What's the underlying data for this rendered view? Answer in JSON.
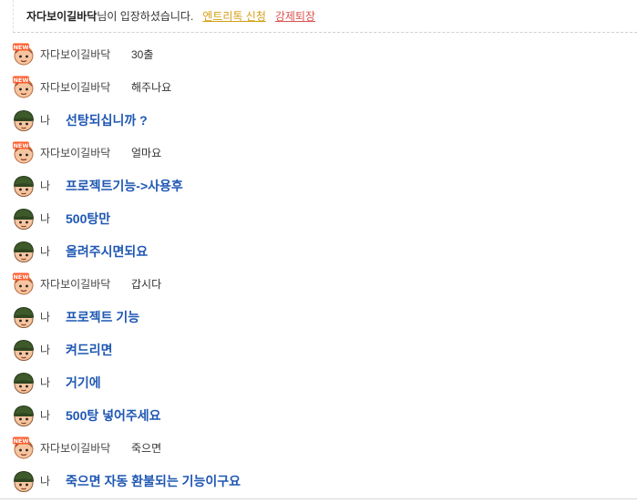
{
  "notice": {
    "nickname": "자다보이길바닥",
    "message": "님이 입장하셨습니다.",
    "entry_label": "엔트리톡 신청",
    "kick_label": "강제퇴장"
  },
  "messages": [
    {
      "type": "other",
      "name": "자다보이길바닥",
      "text": "30출"
    },
    {
      "type": "other",
      "name": "자다보이길바닥",
      "text": "해주나요"
    },
    {
      "type": "me",
      "name": "나",
      "text": "선탕되십니까 ?"
    },
    {
      "type": "other",
      "name": "자다보이길바닥",
      "text": "얼마요"
    },
    {
      "type": "me",
      "name": "나",
      "text": "프로젝트기능->사용후"
    },
    {
      "type": "me",
      "name": "나",
      "text": "500탕만"
    },
    {
      "type": "me",
      "name": "나",
      "text": "올려주시면되요"
    },
    {
      "type": "other",
      "name": "자다보이길바닥",
      "text": "갑시다"
    },
    {
      "type": "me",
      "name": "나",
      "text": "프로젝트 기능"
    },
    {
      "type": "me",
      "name": "나",
      "text": "켜드리면"
    },
    {
      "type": "me",
      "name": "나",
      "text": "거기에"
    },
    {
      "type": "me",
      "name": "나",
      "text": "500탕 넣어주세요"
    },
    {
      "type": "other",
      "name": "자다보이길바닥",
      "text": "죽으면"
    },
    {
      "type": "me",
      "name": "나",
      "text": "죽으면 자동 환불되는 기능이구요"
    }
  ],
  "icons": {
    "other_avatar": "new-user-avatar-icon",
    "me_avatar": "soldier-avatar-icon",
    "new_badge_text": "NEW"
  }
}
